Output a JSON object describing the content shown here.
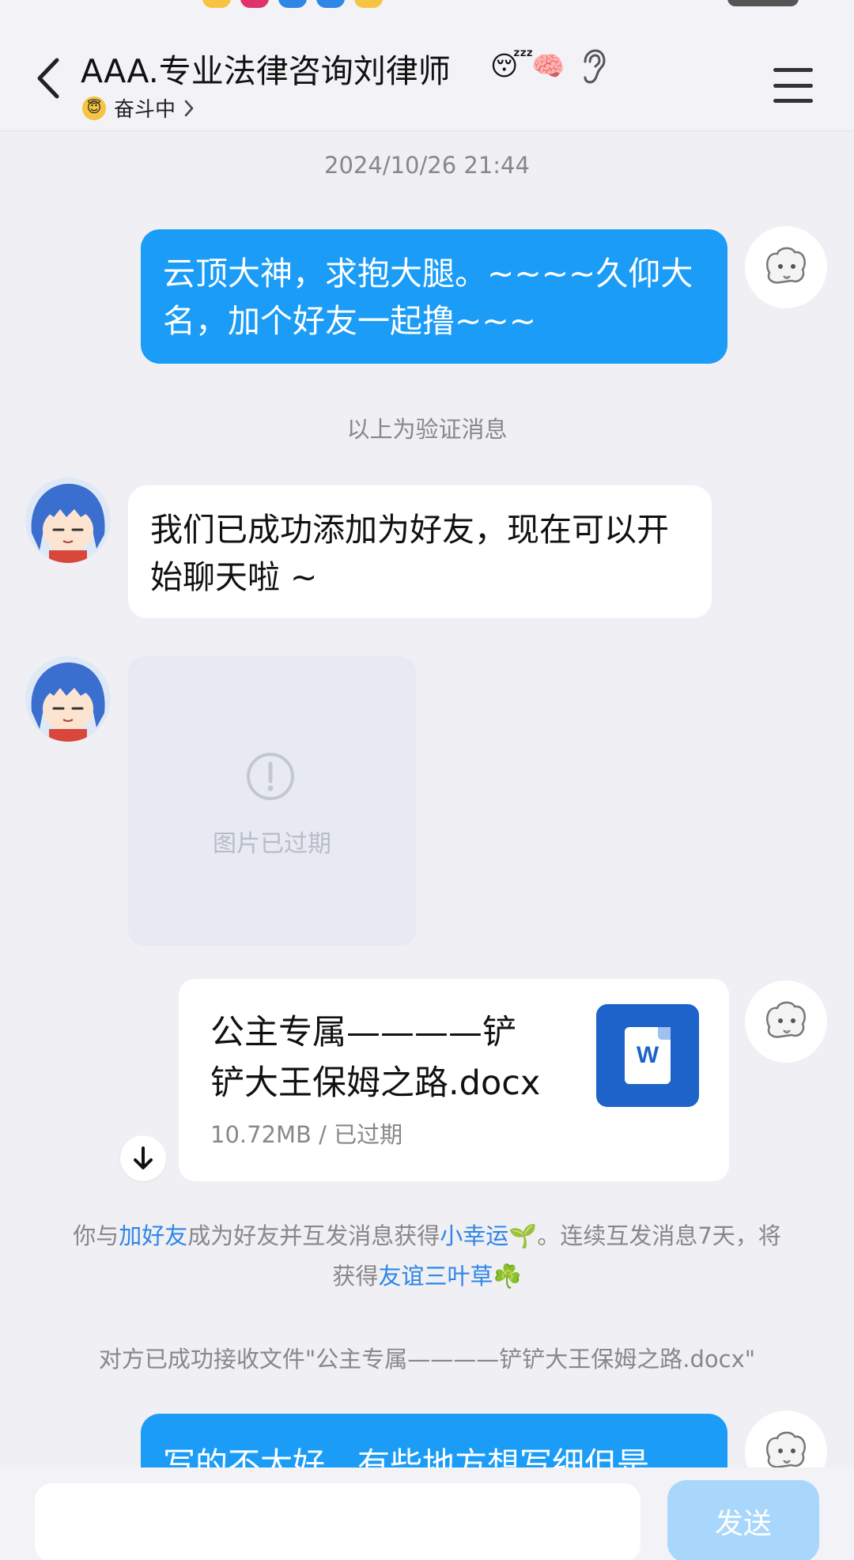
{
  "header": {
    "title": "AAA.专业法律咨询刘律师",
    "status_label": "奋斗中",
    "status_emoji": "😇"
  },
  "chat": {
    "timestamp": "2024/10/26 21:44",
    "messages": [
      {
        "sender": "me",
        "type": "text",
        "text": "云顶大神，求抱大腿。~~~~久仰大名，加个好友一起撸~~~"
      },
      {
        "type": "system",
        "text": "以上为验证消息"
      },
      {
        "sender": "other",
        "type": "text",
        "text": "我们已成功添加为好友，现在可以开始聊天啦 ~"
      },
      {
        "sender": "other",
        "type": "image",
        "status": "图片已过期"
      },
      {
        "sender": "me",
        "type": "file",
        "name": "公主专属————铲铲大王保姆之路.docx",
        "meta": "10.72MB / 已过期"
      },
      {
        "type": "system_rich",
        "parts": {
          "p1": "你与",
          "link1": "加好友",
          "p2": "成为好友并互发消息获得",
          "link2": "小幸运",
          "emoji1": "🌱",
          "p3": "。连续互发消息7天，将获得",
          "link3": "友谊三叶草",
          "emoji2": "☘️"
        }
      },
      {
        "type": "system",
        "text": "对方已成功接收文件\"公主专属————铲铲大王保姆之路.docx\""
      },
      {
        "sender": "me",
        "type": "text",
        "text": "写的不太好，有些地方想写细但是"
      }
    ]
  },
  "input": {
    "send_label": "发送"
  },
  "colors": {
    "my_bubble": "#1a9cf7",
    "link": "#2f86e6",
    "background": "#efeff4",
    "send_button_disabled": "#a9d7fb",
    "word_icon": "#1e63c9"
  }
}
